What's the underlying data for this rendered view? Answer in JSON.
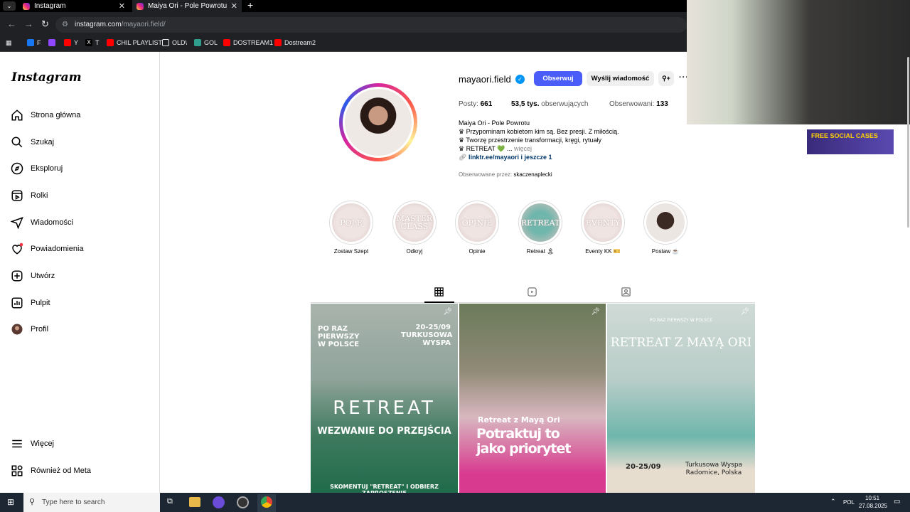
{
  "browser": {
    "tabs": [
      {
        "title": "Instagram"
      },
      {
        "title": "Maiya Ori - Pole Powrotu (@m"
      }
    ],
    "url_domain": "instagram.com",
    "url_path": "/mayaori.field/",
    "bookmarks": [
      "F",
      "Y",
      "T",
      "CHIL PLAYLIST",
      "OLD\\",
      "GOL",
      "DOSTREAM1",
      "Dostream2"
    ]
  },
  "sidebar": {
    "logo": "Instagram",
    "items": [
      {
        "label": "Strona główna",
        "icon": "home-icon"
      },
      {
        "label": "Szukaj",
        "icon": "search-icon"
      },
      {
        "label": "Eksploruj",
        "icon": "compass-icon"
      },
      {
        "label": "Rolki",
        "icon": "reels-icon"
      },
      {
        "label": "Wiadomości",
        "icon": "send-icon"
      },
      {
        "label": "Powiadomienia",
        "icon": "heart-icon"
      },
      {
        "label": "Utwórz",
        "icon": "plus-icon"
      },
      {
        "label": "Pulpit",
        "icon": "dashboard-icon"
      },
      {
        "label": "Profil",
        "icon": "avatar-icon"
      }
    ],
    "bottom_items": [
      {
        "label": "Więcej",
        "icon": "menu-icon"
      },
      {
        "label": "Również od Meta",
        "icon": "meta-icon"
      }
    ]
  },
  "profile": {
    "username": "mayaori.field",
    "follow_label": "Obserwuj",
    "message_label": "Wyślij wiadomość",
    "stats": {
      "posts_label": "Posty:",
      "posts_value": "661",
      "followers_value": "53,5 tys.",
      "followers_label": "obserwujących",
      "following_label": "Obserwowani:",
      "following_value": "133"
    },
    "bio_name": "Maiya Ori - Pole Powrotu",
    "bio_lines": [
      "♛ Przypominam kobietom kim są. Bez presji. Z miłością.",
      "♛ Tworzę przestrzenie transformacji, kręgi, rytuały",
      "♛ RETREAT 💚 ..."
    ],
    "bio_more": "więcej",
    "link": "linktr.ee/mayaori i jeszcze 1",
    "followed_by_label": "Obserwowane przez:",
    "followed_by_user": "skaczenaplecki"
  },
  "highlights": [
    {
      "cover": "POLE",
      "label": "Zostaw Szept"
    },
    {
      "cover": "MASTER CLASS",
      "label": "Odkryj"
    },
    {
      "cover": "OPINIE",
      "label": "Opinie"
    },
    {
      "cover": "RETREAT",
      "label": "Retreat 🏝"
    },
    {
      "cover": "EVENTY",
      "label": "Eventy KK 🎫"
    },
    {
      "cover": "",
      "label": "Postaw ☕"
    }
  ],
  "posts": [
    {
      "top_left": "PO RAZ PIERWSZY W POLSCE",
      "top_right": "20-25/09 TURKUSOWA WYSPA",
      "headline": "RETREAT",
      "sub": "WEZWANIE DO PRZEJŚCIA",
      "footer": "SKOMENTUJ \"RETREAT\" I ODBIERZ ZAPROSZENIE"
    },
    {
      "kicker": "Retreat z Mayą Ori",
      "headline": "Potraktuj to jako priorytet"
    },
    {
      "kicker": "PO RAZ PIERWSZY W POLSCE",
      "headline": "RETREAT Z MAYĄ ORI",
      "date": "20-25/09",
      "place": "Turkusowa Wyspa",
      "place2": "Radomice, Polska"
    }
  ],
  "ad": {
    "text": "FREE SOCIAL CASES"
  },
  "taskbar": {
    "search_placeholder": "Type here to search",
    "lang": "POL",
    "time": "10:51",
    "date": "27.08.2025"
  }
}
